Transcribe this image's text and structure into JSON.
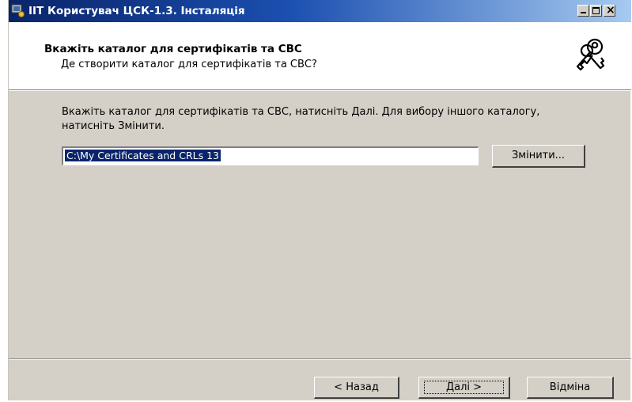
{
  "window": {
    "title": "ІІТ Користувач ЦСК-1.3. Інсталяція"
  },
  "header": {
    "title": "Вкажіть каталог для сертифікатів та СВС",
    "subtitle": "Де створити каталог для сертифікатів та СВС?",
    "icon": "keys-icon"
  },
  "body": {
    "instruction": "Вкажіть каталог для сертифікатів та СВС, натисніть Далі. Для вибору іншого каталогу, натисніть Змінити.",
    "path_value": "C:\\My Certificates and CRLs 13",
    "change_label": "Змінити..."
  },
  "footer": {
    "back_label": "< Назад",
    "next_label": "Далі >",
    "cancel_label": "Відміна"
  },
  "colors": {
    "titlebar_start": "#0a246a",
    "titlebar_end": "#a6caf0",
    "dialog_bg": "#d4d0c8",
    "selection": "#0a246a"
  }
}
